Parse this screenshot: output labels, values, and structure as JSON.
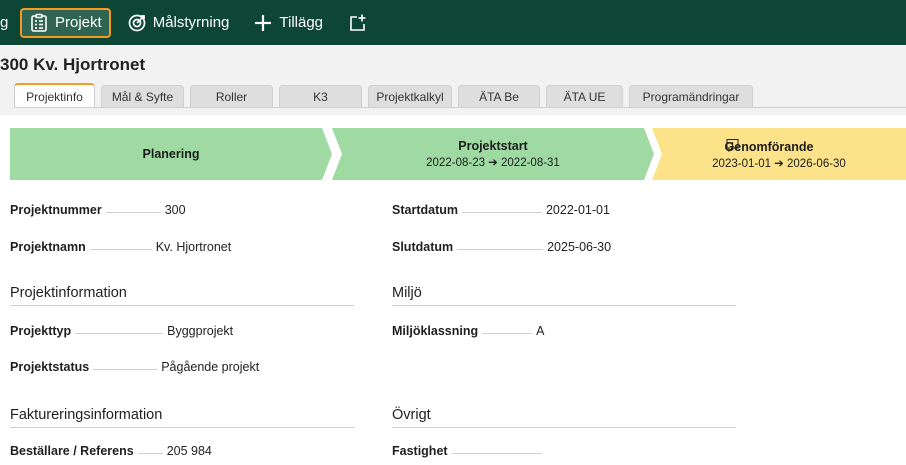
{
  "toolbar": {
    "cut_label": "g",
    "project_label": "Projekt",
    "goals_label": "Målstyrning",
    "addon_label": "Tillägg"
  },
  "project": {
    "title": "300 Kv. Hjortronet"
  },
  "tabs": [
    {
      "label": "Projektinfo",
      "active": true
    },
    {
      "label": "Mål & Syfte"
    },
    {
      "label": "Roller"
    },
    {
      "label": "K3"
    },
    {
      "label": "Projektkalkyl"
    },
    {
      "label": "ÄTA Be"
    },
    {
      "label": "ÄTA UE"
    },
    {
      "label": "Programändringar"
    }
  ],
  "phases": [
    {
      "title": "Planering",
      "dates": "",
      "color": "#9fdaa3"
    },
    {
      "title": "Projektstart",
      "dates": "2022-08-23 ➔ 2022-08-31",
      "color": "#9fdaa3"
    },
    {
      "title": "Genomförande",
      "dates": "2023-01-01 ➔ 2026-06-30",
      "color": "#fce38a",
      "comments": "1"
    }
  ],
  "fields": {
    "projektnummer": {
      "label": "Projektnummer",
      "value": "300"
    },
    "projektnamn": {
      "label": "Projektnamn",
      "value": "Kv. Hjortronet"
    },
    "startdatum": {
      "label": "Startdatum",
      "value": "2022-01-01"
    },
    "slutdatum": {
      "label": "Slutdatum",
      "value": "2025-06-30"
    },
    "projekttyp": {
      "label": "Projekttyp",
      "value": "Byggprojekt"
    },
    "projektstatus": {
      "label": "Projektstatus",
      "value": "Pågående projekt"
    },
    "miljoklassning": {
      "label": "Miljöklassning",
      "value": "A"
    },
    "bestallare": {
      "label": "Beställare / Referens",
      "value": "205 984"
    },
    "fastighet": {
      "label": "Fastighet",
      "value": ""
    }
  },
  "sections": {
    "projektinformation": "Projektinformation",
    "miljo": "Miljö",
    "fakturering": "Faktureringsinformation",
    "ovrigt": "Övrigt"
  },
  "colors": {
    "toolbar_bg": "#0e4636",
    "accent": "#f59a23",
    "phase_done": "#9fdaa3",
    "phase_current": "#fce38a"
  },
  "icons": {
    "project": "clipboard-icon",
    "goals": "target-icon",
    "addon": "plus-icon",
    "new": "add-window-icon",
    "comment": "comment-icon"
  }
}
